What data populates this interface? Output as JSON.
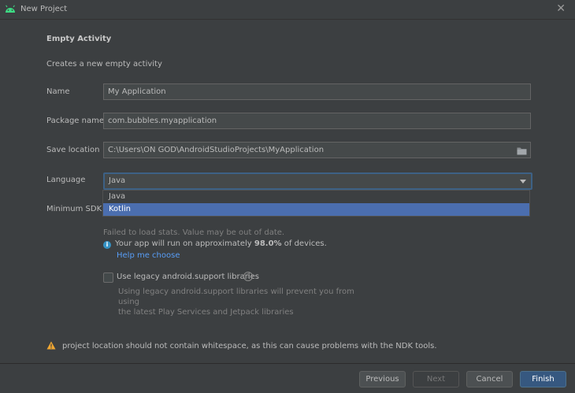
{
  "window": {
    "title": "New Project",
    "close_glyph": "✕"
  },
  "template": {
    "heading": "Empty Activity",
    "description": "Creates a new empty activity"
  },
  "form": {
    "name_label": "Name",
    "name_value": "My Application",
    "package_label": "Package name",
    "package_value": "com.bubbles.myapplication",
    "save_label": "Save location",
    "save_value": "C:\\Users\\ON GOD\\AndroidStudioProjects\\MyApplication",
    "language_label": "Language",
    "language_value": "Java",
    "language_options": [
      "Java",
      "Kotlin"
    ],
    "language_highlighted": "Kotlin",
    "min_sdk_label": "Minimum SDK"
  },
  "stats": {
    "failed_text": "Failed to load stats. Value may be out of date.",
    "info_prefix": "Your app will run on approximately ",
    "info_percent": "98.0%",
    "info_suffix": " of devices.",
    "help_link": "Help me choose"
  },
  "legacy": {
    "checkbox_label": "Use legacy android.support libraries",
    "checked": false,
    "desc_line1": "Using legacy android.support libraries will prevent you from using",
    "desc_line2": "the latest Play Services and Jetpack libraries"
  },
  "warning": {
    "text": "project location should not contain whitespace, as this can cause problems with the NDK tools."
  },
  "buttons": {
    "previous": "Previous",
    "next": "Next",
    "cancel": "Cancel",
    "finish": "Finish"
  },
  "colors": {
    "background": "#3c3f41",
    "accent": "#4b6eaf",
    "link": "#589df6",
    "warning": "#f0a732",
    "info": "#3592c4"
  }
}
